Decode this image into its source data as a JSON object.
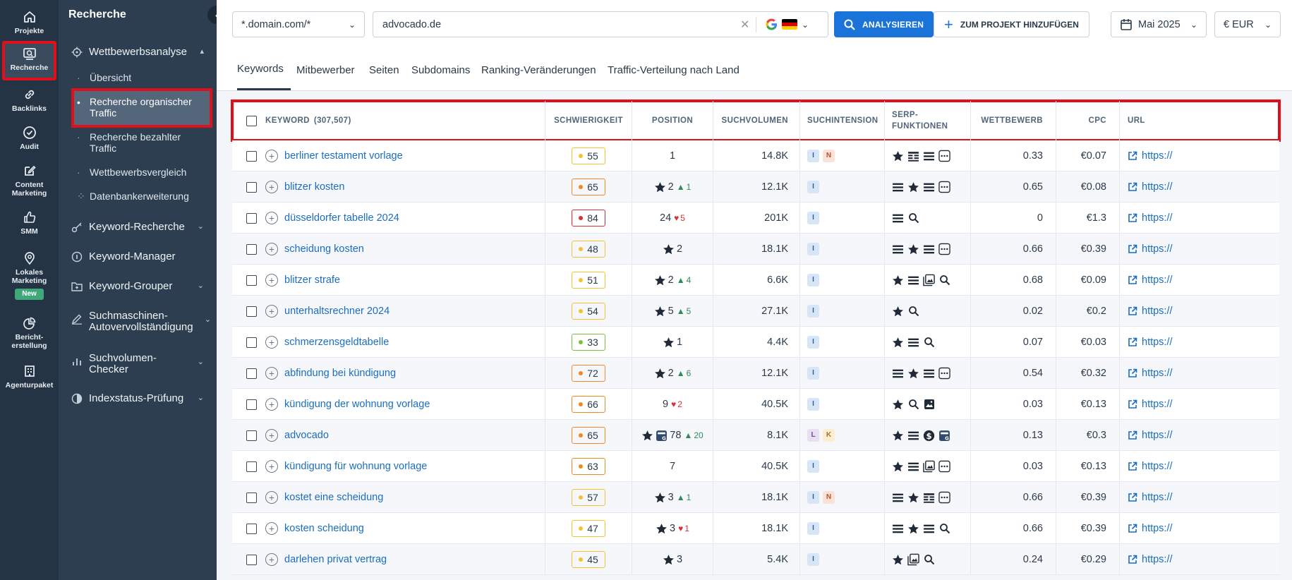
{
  "rail": {
    "items": [
      {
        "label": "Projekte",
        "icon": "home-icon"
      },
      {
        "label": "Recherche",
        "icon": "research-icon"
      },
      {
        "label": "Backlinks",
        "icon": "link-icon"
      },
      {
        "label": "Audit",
        "icon": "check-circle-icon"
      },
      {
        "label": "Content Marketing",
        "icon": "edit-icon"
      },
      {
        "label": "SMM",
        "icon": "thumbs-up-icon"
      },
      {
        "label": "Lokales Marketing",
        "icon": "location-pin-icon",
        "badge": "New"
      },
      {
        "label": "Bericht-erstellung",
        "icon": "pie-chart-icon"
      },
      {
        "label": "Agenturpaket",
        "icon": "building-icon"
      }
    ]
  },
  "subnav": {
    "title": "Recherche",
    "collapse_icon": "chevron-left-icon",
    "groups": [
      {
        "label": "Wettbewerbsanalyse",
        "expanded": true
      },
      {
        "label": "Keyword-Recherche"
      },
      {
        "label": "Keyword-Manager"
      },
      {
        "label": "Keyword-Grouper"
      },
      {
        "label": "Suchmaschinen-Autovervollständigung"
      },
      {
        "label": "Suchvolumen-Checker"
      },
      {
        "label": "Indexstatus-Prüfung"
      }
    ],
    "sub_items": [
      {
        "label": "Übersicht"
      },
      {
        "label": "Recherche organischer Traffic",
        "active": true
      },
      {
        "label": "Recherche bezahlter Traffic"
      },
      {
        "label": "Wettbewerbsvergleich"
      },
      {
        "label": "Datenbankerweiterung"
      }
    ]
  },
  "topbar": {
    "scope_select": "*.domain.com/*",
    "domain_input": "advocado.de",
    "analyze_label": "ANALYSIEREN",
    "add_project_label": "ZUM PROJEKT HINZUFÜGEN",
    "date_select": "Mai 2025",
    "currency_select": "€ EUR"
  },
  "tabs": [
    "Keywords",
    "Mitbewerber",
    "Seiten",
    "Subdomains",
    "Ranking-Veränderungen",
    "Traffic-Verteilung nach Land"
  ],
  "table": {
    "headers": {
      "keyword": "KEYWORD",
      "keyword_count": "(307,507)",
      "difficulty": "SCHWIERIGKEIT",
      "position": "POSITION",
      "volume": "SUCHVOLUMEN",
      "intent": "SUCHINTENSION",
      "serp": "SERP-FUNKTIONEN",
      "competition": "WETTBEWERB",
      "cpc": "CPC",
      "url": "URL"
    },
    "url_text": "https://",
    "colors": {
      "difficulty_yellow": "#f1c232",
      "difficulty_orange": "#f08a24",
      "difficulty_green": "#7ac143",
      "difficulty_red": "#d93030"
    },
    "rows": [
      {
        "keyword": "berliner testament vorlage",
        "difficulty": "55",
        "dlevel": "yellow",
        "pos_icons": [],
        "position": "1",
        "change": "",
        "dir": "",
        "volume": "14.8K",
        "intents": [
          "I",
          "N"
        ],
        "serp": [
          "star",
          "table",
          "list",
          "more"
        ],
        "competition": "0.33",
        "cpc": "€0.07"
      },
      {
        "keyword": "blitzer kosten",
        "difficulty": "65",
        "dlevel": "orange",
        "pos_icons": [
          "star"
        ],
        "position": "2",
        "change": "1",
        "dir": "up",
        "volume": "12.1K",
        "intents": [
          "I"
        ],
        "serp": [
          "list",
          "star",
          "list",
          "more"
        ],
        "competition": "0.65",
        "cpc": "€0.08"
      },
      {
        "keyword": "düsseldorfer tabelle 2024",
        "difficulty": "84",
        "dlevel": "red",
        "pos_icons": [],
        "position": "24",
        "change": "5",
        "dir": "down",
        "volume": "201K",
        "intents": [
          "I"
        ],
        "serp": [
          "list",
          "search"
        ],
        "competition": "0",
        "cpc": "€1.3"
      },
      {
        "keyword": "scheidung kosten",
        "difficulty": "48",
        "dlevel": "yellow",
        "pos_icons": [
          "star"
        ],
        "position": "2",
        "change": "",
        "dir": "",
        "volume": "18.1K",
        "intents": [
          "I"
        ],
        "serp": [
          "list",
          "star",
          "list",
          "more"
        ],
        "competition": "0.66",
        "cpc": "€0.39"
      },
      {
        "keyword": "blitzer strafe",
        "difficulty": "51",
        "dlevel": "yellow",
        "pos_icons": [
          "star"
        ],
        "position": "2",
        "change": "4",
        "dir": "up",
        "volume": "6.6K",
        "intents": [
          "I"
        ],
        "serp": [
          "star",
          "list",
          "images",
          "search"
        ],
        "competition": "0.68",
        "cpc": "€0.09"
      },
      {
        "keyword": "unterhaltsrechner 2024",
        "difficulty": "54",
        "dlevel": "yellow",
        "pos_icons": [
          "star"
        ],
        "position": "5",
        "change": "5",
        "dir": "up",
        "volume": "27.1K",
        "intents": [
          "I"
        ],
        "serp": [
          "star",
          "search"
        ],
        "competition": "0.02",
        "cpc": "€0.2"
      },
      {
        "keyword": "schmerzensgeldtabelle",
        "difficulty": "33",
        "dlevel": "green",
        "pos_icons": [
          "star"
        ],
        "position": "1",
        "change": "",
        "dir": "",
        "volume": "4.4K",
        "intents": [
          "I"
        ],
        "serp": [
          "star",
          "list",
          "search"
        ],
        "competition": "0.07",
        "cpc": "€0.03"
      },
      {
        "keyword": "abfindung bei kündigung",
        "difficulty": "72",
        "dlevel": "orange",
        "pos_icons": [
          "star"
        ],
        "position": "2",
        "change": "6",
        "dir": "up",
        "volume": "12.1K",
        "intents": [
          "I"
        ],
        "serp": [
          "list",
          "star",
          "list",
          "more"
        ],
        "competition": "0.54",
        "cpc": "€0.32"
      },
      {
        "keyword": "kündigung der wohnung vorlage",
        "difficulty": "66",
        "dlevel": "orange",
        "pos_icons": [],
        "position": "9",
        "change": "2",
        "dir": "down",
        "volume": "40.5K",
        "intents": [
          "I"
        ],
        "serp": [
          "star",
          "search",
          "image"
        ],
        "competition": "0.03",
        "cpc": "€0.13"
      },
      {
        "keyword": "advocado",
        "difficulty": "65",
        "dlevel": "orange",
        "pos_icons": [
          "star",
          "shop"
        ],
        "position": "78",
        "change": "20",
        "dir": "up",
        "volume": "8.1K",
        "intents": [
          "L",
          "K"
        ],
        "serp": [
          "star",
          "list",
          "dollar",
          "shop"
        ],
        "competition": "0.13",
        "cpc": "€0.3"
      },
      {
        "keyword": "kündigung für wohnung vorlage",
        "difficulty": "63",
        "dlevel": "orange",
        "pos_icons": [],
        "position": "7",
        "change": "",
        "dir": "",
        "volume": "40.5K",
        "intents": [
          "I"
        ],
        "serp": [
          "star",
          "list",
          "images",
          "more"
        ],
        "competition": "0.03",
        "cpc": "€0.13"
      },
      {
        "keyword": "kostet eine scheidung",
        "difficulty": "57",
        "dlevel": "yellow",
        "pos_icons": [
          "star"
        ],
        "position": "3",
        "change": "1",
        "dir": "up",
        "volume": "18.1K",
        "intents": [
          "I",
          "N"
        ],
        "serp": [
          "list",
          "star",
          "table",
          "more"
        ],
        "competition": "0.66",
        "cpc": "€0.39"
      },
      {
        "keyword": "kosten scheidung",
        "difficulty": "47",
        "dlevel": "yellow",
        "pos_icons": [
          "star"
        ],
        "position": "3",
        "change": "1",
        "dir": "down",
        "volume": "18.1K",
        "intents": [
          "I"
        ],
        "serp": [
          "list",
          "star",
          "list",
          "search"
        ],
        "competition": "0.66",
        "cpc": "€0.39"
      },
      {
        "keyword": "darlehen privat vertrag",
        "difficulty": "45",
        "dlevel": "yellow",
        "pos_icons": [
          "star"
        ],
        "position": "3",
        "change": "",
        "dir": "",
        "volume": "5.4K",
        "intents": [
          "I"
        ],
        "serp": [
          "star",
          "images",
          "search"
        ],
        "competition": "0.24",
        "cpc": "€0.29"
      }
    ]
  }
}
